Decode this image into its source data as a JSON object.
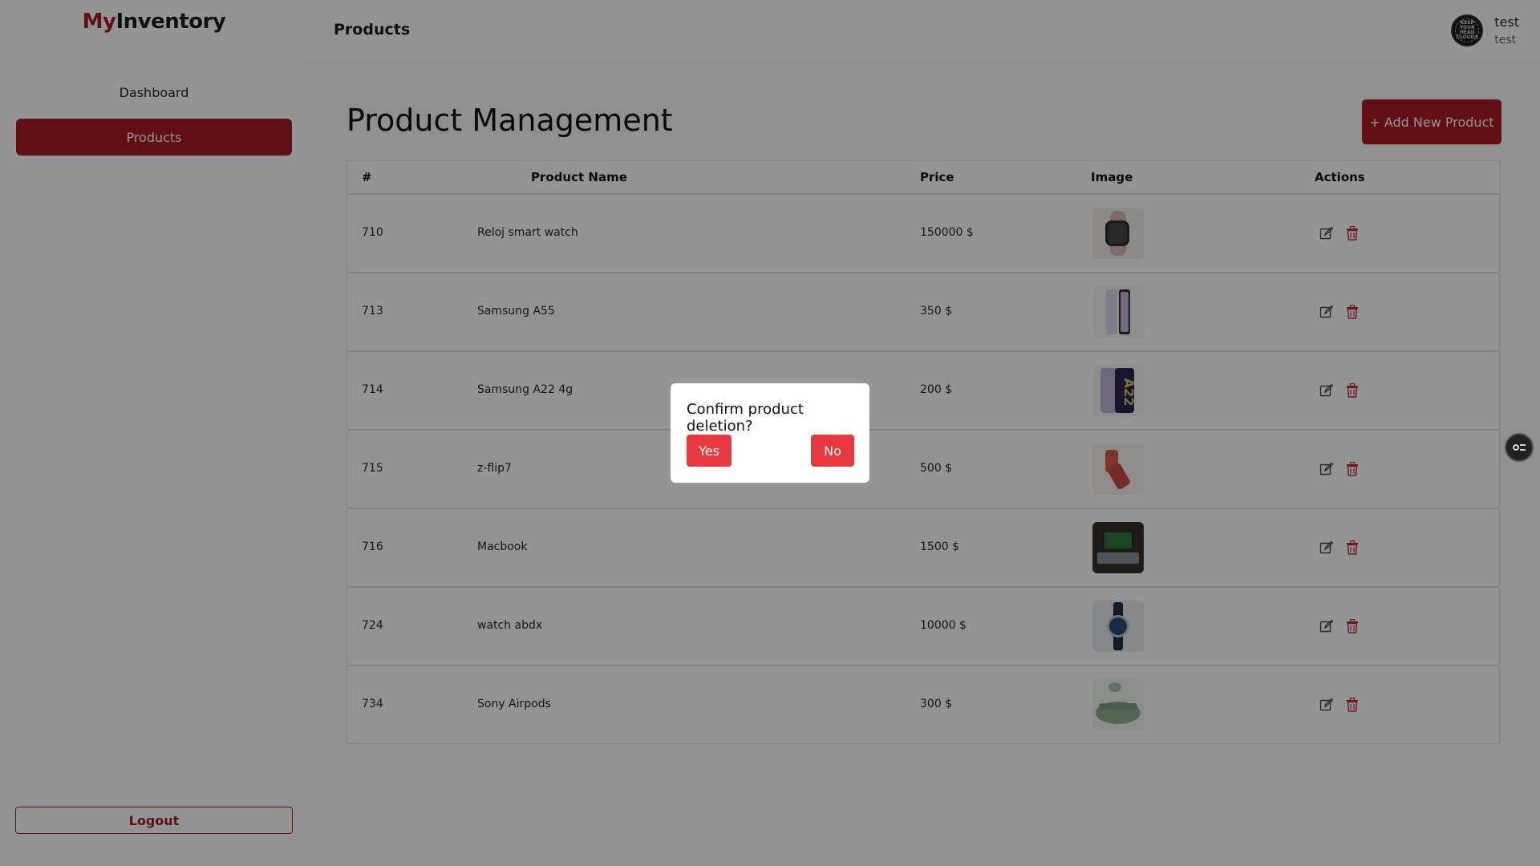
{
  "app": {
    "brand_prefix": "My",
    "brand_suffix": "Inventory",
    "page_heading": "Products"
  },
  "user": {
    "name": "test",
    "subtitle": "test",
    "avatar_text": "KEEP YOUR HEAD CLOUDS"
  },
  "sidebar": {
    "items": [
      {
        "label": "Dashboard",
        "active": false
      },
      {
        "label": "Products",
        "active": true
      }
    ],
    "logout_label": "Logout"
  },
  "main": {
    "title": "Product Management",
    "add_button_label": "+ Add New Product",
    "columns": [
      "#",
      "Product Name",
      "Price",
      "Image",
      "Actions"
    ],
    "rows": [
      {
        "id": "710",
        "name": "Reloj smart watch",
        "price": "150000 $",
        "image": "smartwatch"
      },
      {
        "id": "713",
        "name": "Samsung A55",
        "price": "350 $",
        "image": "phone-a55"
      },
      {
        "id": "714",
        "name": "Samsung A22 4g",
        "price": "200 $",
        "image": "phone-a22"
      },
      {
        "id": "715",
        "name": "z-flip7",
        "price": "500 $",
        "image": "phone-flip"
      },
      {
        "id": "716",
        "name": "Macbook",
        "price": "1500 $",
        "image": "laptop"
      },
      {
        "id": "724",
        "name": "watch abdx",
        "price": "10000 $",
        "image": "wristwatch"
      },
      {
        "id": "734",
        "name": "Sony Airpods",
        "price": "300 $",
        "image": "earbuds"
      }
    ]
  },
  "modal": {
    "text": "Confirm product deletion?",
    "yes_label": "Yes",
    "no_label": "No"
  },
  "colors": {
    "accent": "#a51d22",
    "danger": "#e5393f"
  }
}
